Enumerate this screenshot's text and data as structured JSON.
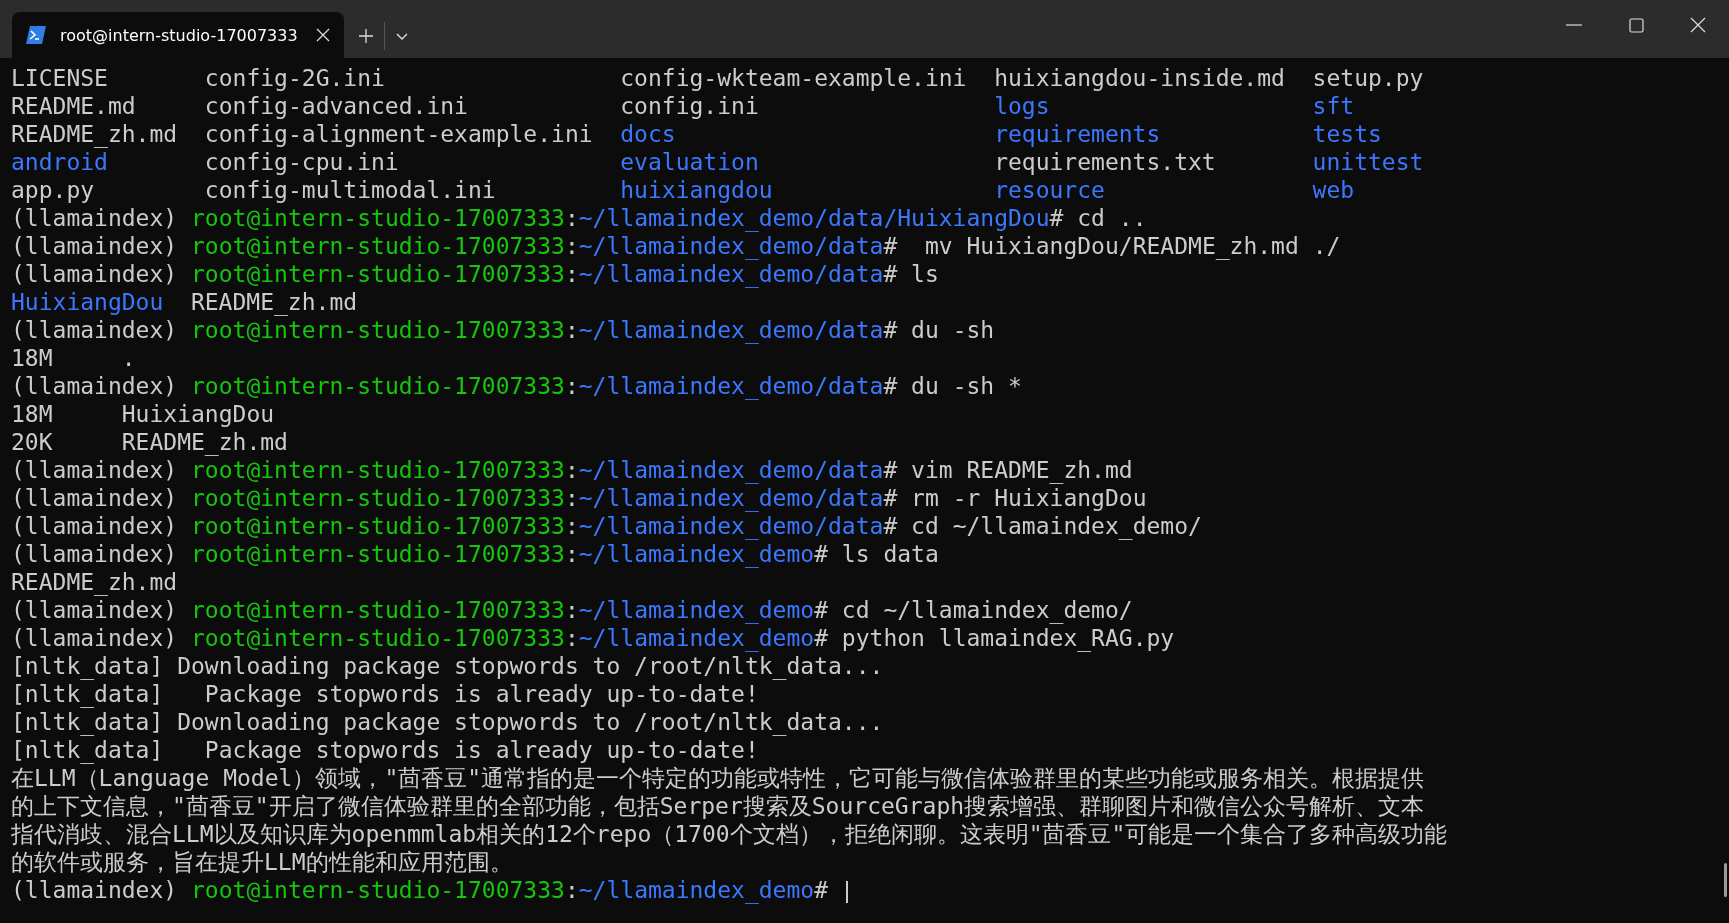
{
  "tab": {
    "title": "root@intern-studio-17007333",
    "selected": true
  },
  "lines": [
    {
      "kind": "listing",
      "columns": [
        [
          {
            "name": "LICENSE",
            "dir": false
          },
          {
            "name": "README.md",
            "dir": false
          },
          {
            "name": "README_zh.md",
            "dir": false
          },
          {
            "name": "android",
            "dir": true
          },
          {
            "name": "app.py",
            "dir": false
          }
        ],
        [
          {
            "name": "config-2G.ini",
            "dir": false
          },
          {
            "name": "config-advanced.ini",
            "dir": false
          },
          {
            "name": "config-alignment-example.ini",
            "dir": false
          },
          {
            "name": "config-cpu.ini",
            "dir": false
          },
          {
            "name": "config-multimodal.ini",
            "dir": false
          }
        ],
        [
          {
            "name": "config-wkteam-example.ini",
            "dir": false
          },
          {
            "name": "config.ini",
            "dir": false
          },
          {
            "name": "docs",
            "dir": true
          },
          {
            "name": "evaluation",
            "dir": true
          },
          {
            "name": "huixiangdou",
            "dir": true
          }
        ],
        [
          {
            "name": "huixiangdou-inside.md",
            "dir": false
          },
          {
            "name": "logs",
            "dir": true
          },
          {
            "name": "requirements",
            "dir": true
          },
          {
            "name": "requirements.txt",
            "dir": false
          },
          {
            "name": "resource",
            "dir": true
          }
        ],
        [
          {
            "name": "setup.py",
            "dir": false
          },
          {
            "name": "sft",
            "dir": true
          },
          {
            "name": "tests",
            "dir": true
          },
          {
            "name": "unittest",
            "dir": true
          },
          {
            "name": "web",
            "dir": true
          }
        ]
      ]
    },
    {
      "kind": "prompt",
      "env": "(llamaindex) ",
      "user": "root@intern-studio-17007333",
      "sep": ":",
      "path": "~/llamaindex_demo/data/HuixiangDou",
      "command": "# cd .."
    },
    {
      "kind": "prompt",
      "env": "(llamaindex) ",
      "user": "root@intern-studio-17007333",
      "sep": ":",
      "path": "~/llamaindex_demo/data",
      "command": "#  mv HuixiangDou/README_zh.md ./"
    },
    {
      "kind": "prompt",
      "env": "(llamaindex) ",
      "user": "root@intern-studio-17007333",
      "sep": ":",
      "path": "~/llamaindex_demo/data",
      "command": "# ls"
    },
    {
      "kind": "files",
      "items": [
        {
          "name": "HuixiangDou",
          "dir": true
        },
        {
          "name": "README_zh.md",
          "dir": false
        }
      ]
    },
    {
      "kind": "prompt",
      "env": "(llamaindex) ",
      "user": "root@intern-studio-17007333",
      "sep": ":",
      "path": "~/llamaindex_demo/data",
      "command": "# du -sh"
    },
    {
      "kind": "output",
      "text": "18M     ."
    },
    {
      "kind": "prompt",
      "env": "(llamaindex) ",
      "user": "root@intern-studio-17007333",
      "sep": ":",
      "path": "~/llamaindex_demo/data",
      "command": "# du -sh *"
    },
    {
      "kind": "output",
      "text": "18M     HuixiangDou"
    },
    {
      "kind": "output",
      "text": "20K     README_zh.md"
    },
    {
      "kind": "prompt",
      "env": "(llamaindex) ",
      "user": "root@intern-studio-17007333",
      "sep": ":",
      "path": "~/llamaindex_demo/data",
      "command": "# vim README_zh.md"
    },
    {
      "kind": "prompt",
      "env": "(llamaindex) ",
      "user": "root@intern-studio-17007333",
      "sep": ":",
      "path": "~/llamaindex_demo/data",
      "command": "# rm -r HuixiangDou"
    },
    {
      "kind": "prompt",
      "env": "(llamaindex) ",
      "user": "root@intern-studio-17007333",
      "sep": ":",
      "path": "~/llamaindex_demo/data",
      "command": "# cd ~/llamaindex_demo/"
    },
    {
      "kind": "prompt",
      "env": "(llamaindex) ",
      "user": "root@intern-studio-17007333",
      "sep": ":",
      "path": "~/llamaindex_demo",
      "command": "# ls data"
    },
    {
      "kind": "output",
      "text": "README_zh.md"
    },
    {
      "kind": "prompt",
      "env": "(llamaindex) ",
      "user": "root@intern-studio-17007333",
      "sep": ":",
      "path": "~/llamaindex_demo",
      "command": "# cd ~/llamaindex_demo/"
    },
    {
      "kind": "prompt",
      "env": "(llamaindex) ",
      "user": "root@intern-studio-17007333",
      "sep": ":",
      "path": "~/llamaindex_demo",
      "command": "# python llamaindex_RAG.py"
    },
    {
      "kind": "output",
      "text": "[nltk_data] Downloading package stopwords to /root/nltk_data..."
    },
    {
      "kind": "output",
      "text": "[nltk_data]   Package stopwords is already up-to-date!"
    },
    {
      "kind": "output",
      "text": "[nltk_data] Downloading package stopwords to /root/nltk_data..."
    },
    {
      "kind": "output",
      "text": "[nltk_data]   Package stopwords is already up-to-date!"
    },
    {
      "kind": "output",
      "text": "在LLM（Language Model）领域，\"茴香豆\"通常指的是一个特定的功能或特性，它可能与微信体验群里的某些功能或服务相关。根据提供"
    },
    {
      "kind": "output",
      "text": "的上下文信息，\"茴香豆\"开启了微信体验群里的全部功能，包括Serper搜索及SourceGraph搜索增强、群聊图片和微信公众号解析、文本"
    },
    {
      "kind": "output",
      "text": "指代消歧、混合LLM以及知识库为openmmlab相关的12个repo（1700个文档），拒绝闲聊。这表明\"茴香豆\"可能是一个集合了多种高级功能"
    },
    {
      "kind": "output",
      "text": "的软件或服务，旨在提升LLM的性能和应用范围。"
    },
    {
      "kind": "prompt",
      "env": "(llamaindex) ",
      "user": "root@intern-studio-17007333",
      "sep": ":",
      "path": "~/llamaindex_demo",
      "command": "# ",
      "cursor": true
    }
  ]
}
